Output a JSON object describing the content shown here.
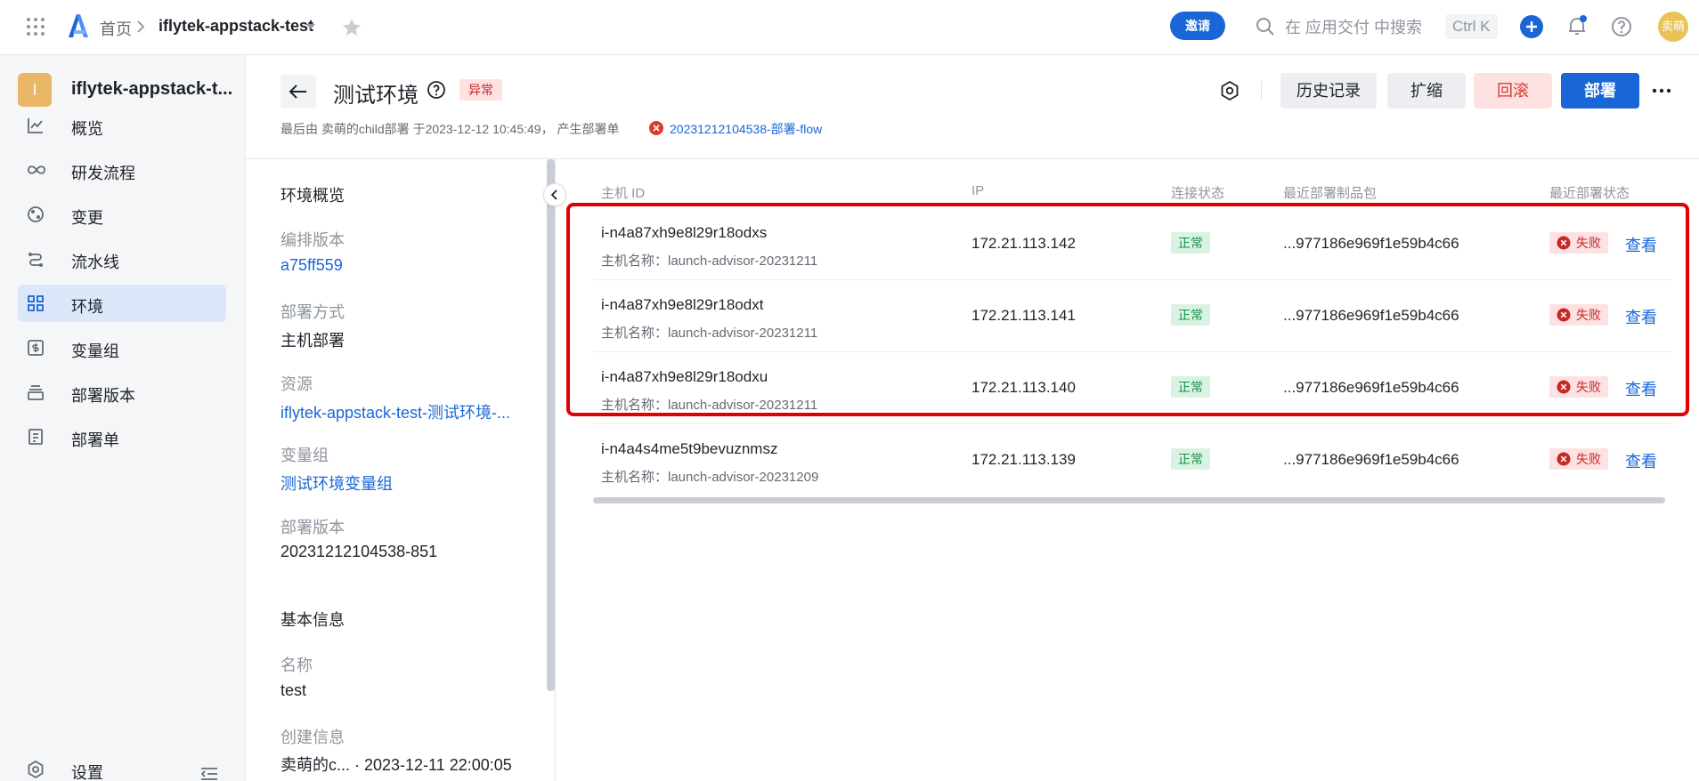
{
  "topbar": {
    "breadcrumb_home": "首页",
    "project_name": "iflytek-appstack-test",
    "invite_label": "邀请",
    "search_placeholder": "在 应用交付 中搜索",
    "search_shortcut": "Ctrl K",
    "avatar_text": "卖萌"
  },
  "sidebar": {
    "project_initial": "I",
    "project_name": "iflytek-appstack-t...",
    "items": [
      {
        "label": "概览",
        "icon": "chart-line-icon"
      },
      {
        "label": "研发流程",
        "icon": "infinity-icon"
      },
      {
        "label": "变更",
        "icon": "change-icon"
      },
      {
        "label": "流水线",
        "icon": "pipeline-icon"
      },
      {
        "label": "环境",
        "icon": "environment-grid-icon",
        "active": true
      },
      {
        "label": "变量组",
        "icon": "variable-group-icon"
      },
      {
        "label": "部署版本",
        "icon": "deploy-version-icon"
      },
      {
        "label": "部署单",
        "icon": "deploy-order-icon"
      }
    ],
    "settings_label": "设置"
  },
  "header": {
    "title": "测试环境",
    "status_badge": "异常",
    "meta_text": "最后由 卖萌的child部署 于2023-12-12 10:45:49， 产生部署单",
    "flow_link": "20231212104538-部署-flow",
    "buttons": {
      "history": "历史记录",
      "scale": "扩缩",
      "rollback": "回滚",
      "deploy": "部署"
    }
  },
  "overview": {
    "section_title": "环境概览",
    "fields": [
      {
        "label": "编排版本",
        "value": "a75ff559",
        "link": true
      },
      {
        "label": "部署方式",
        "value": "主机部署",
        "link": false
      },
      {
        "label": "资源",
        "value": "iflytek-appstack-test-测试环境-...",
        "link": true
      },
      {
        "label": "变量组",
        "value": "测试环境变量组",
        "link": true
      },
      {
        "label": "部署版本",
        "value": "20231212104538-851",
        "link": false
      }
    ],
    "basic_title": "基本信息",
    "basic_fields": [
      {
        "label": "名称",
        "value": "test"
      },
      {
        "label": "创建信息",
        "value": "卖萌的c... · 2023-12-11 22:00:05"
      }
    ]
  },
  "hosts_table": {
    "columns": [
      "主机 ID",
      "IP",
      "连接状态",
      "最近部署制品包",
      "最近部署状态"
    ],
    "rows": [
      {
        "id": "i-n4a87xh9e8l29r18odxs",
        "host_name": "主机名称：launch-advisor-20231211",
        "ip": "172.21.113.142",
        "conn": "正常",
        "package": "...977186e969f1e59b4c66",
        "status": "失败",
        "action": "查看"
      },
      {
        "id": "i-n4a87xh9e8l29r18odxt",
        "host_name": "主机名称：launch-advisor-20231211",
        "ip": "172.21.113.141",
        "conn": "正常",
        "package": "...977186e969f1e59b4c66",
        "status": "失败",
        "action": "查看"
      },
      {
        "id": "i-n4a87xh9e8l29r18odxu",
        "host_name": "主机名称：launch-advisor-20231211",
        "ip": "172.21.113.140",
        "conn": "正常",
        "package": "...977186e969f1e59b4c66",
        "status": "失败",
        "action": "查看"
      },
      {
        "id": "i-n4a4s4me5t9bevuznmsz",
        "host_name": "主机名称：launch-advisor-20231209",
        "ip": "172.21.113.139",
        "conn": "正常",
        "package": "...977186e969f1e59b4c66",
        "status": "失败",
        "action": "查看"
      }
    ]
  },
  "colors": {
    "accent": "#1a66d6",
    "danger": "#c62828",
    "success": "#1a8f4f",
    "highlight_box": "#e00000"
  }
}
